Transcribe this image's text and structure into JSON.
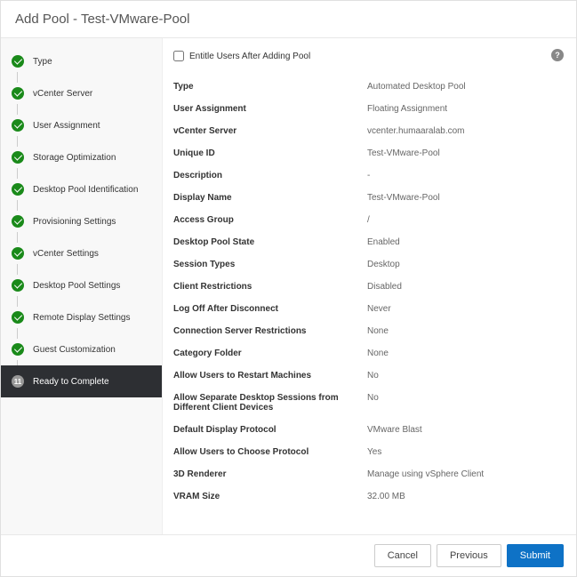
{
  "header": {
    "title": "Add Pool - Test-VMware-Pool"
  },
  "sidebar": {
    "steps": [
      {
        "label": "Type",
        "status": "done"
      },
      {
        "label": "vCenter Server",
        "status": "done"
      },
      {
        "label": "User Assignment",
        "status": "done"
      },
      {
        "label": "Storage Optimization",
        "status": "done"
      },
      {
        "label": "Desktop Pool Identification",
        "status": "done"
      },
      {
        "label": "Provisioning Settings",
        "status": "done"
      },
      {
        "label": "vCenter Settings",
        "status": "done"
      },
      {
        "label": "Desktop Pool Settings",
        "status": "done"
      },
      {
        "label": "Remote Display Settings",
        "status": "done"
      },
      {
        "label": "Guest Customization",
        "status": "done"
      },
      {
        "label": "Ready to Complete",
        "status": "active",
        "num": "11"
      }
    ]
  },
  "content": {
    "checkbox_label": "Entitle Users After Adding Pool",
    "summary": [
      {
        "label": "Type",
        "value": "Automated Desktop Pool"
      },
      {
        "label": "User Assignment",
        "value": "Floating Assignment"
      },
      {
        "label": "vCenter Server",
        "value": "vcenter.humaaralab.com"
      },
      {
        "label": "Unique ID",
        "value": "Test-VMware-Pool"
      },
      {
        "label": "Description",
        "value": "-"
      },
      {
        "label": "Display Name",
        "value": "Test-VMware-Pool"
      },
      {
        "label": "Access Group",
        "value": "/"
      },
      {
        "label": "Desktop Pool State",
        "value": "Enabled"
      },
      {
        "label": "Session Types",
        "value": "Desktop"
      },
      {
        "label": "Client Restrictions",
        "value": "Disabled"
      },
      {
        "label": "Log Off After Disconnect",
        "value": "Never"
      },
      {
        "label": "Connection Server Restrictions",
        "value": "None"
      },
      {
        "label": "Category Folder",
        "value": "None"
      },
      {
        "label": "Allow Users to Restart Machines",
        "value": "No"
      },
      {
        "label": "Allow Separate Desktop Sessions from Different Client Devices",
        "value": "No"
      },
      {
        "label": "Default Display Protocol",
        "value": "VMware Blast"
      },
      {
        "label": "Allow Users to Choose Protocol",
        "value": "Yes"
      },
      {
        "label": "3D Renderer",
        "value": "Manage using vSphere Client"
      },
      {
        "label": "VRAM Size",
        "value": "32.00 MB"
      }
    ]
  },
  "footer": {
    "cancel": "Cancel",
    "previous": "Previous",
    "submit": "Submit"
  }
}
